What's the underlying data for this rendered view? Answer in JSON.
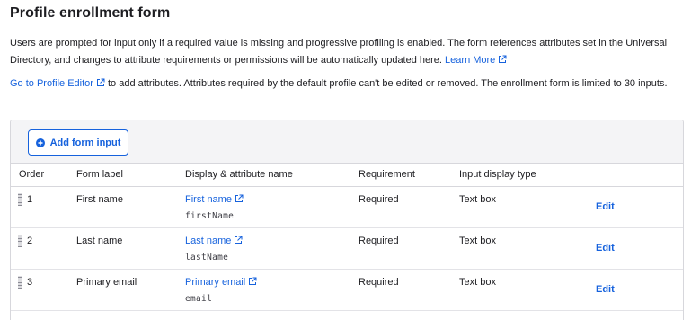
{
  "page": {
    "title": "Profile enrollment form",
    "intro_text": "Users are prompted for input only if a required value is missing and progressive profiling is enabled. The form references attributes set in the Universal Directory, and changes to attribute requirements or permissions will be automatically updated here.",
    "learn_more_label": "Learn More",
    "profile_editor_link": "Go to Profile Editor",
    "profile_editor_text": "to add attributes. Attributes required by the default profile can't be edited or removed. The enrollment form is limited to 30 inputs."
  },
  "toolbar": {
    "add_form_input_label": "Add form input",
    "add_icon": "plus-circle-icon"
  },
  "table": {
    "columns": [
      "Order",
      "Form label",
      "Display & attribute name",
      "Requirement",
      "Input display type",
      ""
    ],
    "rows": [
      {
        "order": "1",
        "form_label": "First name",
        "display_name": "First name",
        "attribute": "firstName",
        "requirement": "Required",
        "input_type": "Text box",
        "action": "Edit"
      },
      {
        "order": "2",
        "form_label": "Last name",
        "display_name": "Last name",
        "attribute": "lastName",
        "requirement": "Required",
        "input_type": "Text box",
        "action": "Edit"
      },
      {
        "order": "3",
        "form_label": "Primary email",
        "display_name": "Primary email",
        "attribute": "email",
        "requirement": "Required",
        "input_type": "Text box",
        "action": "Edit"
      }
    ]
  },
  "colors": {
    "accent": "#1662dd",
    "text": "#1d1d21",
    "header_bg": "#f4f4f6",
    "border": "#d7d7dc"
  },
  "icons": {
    "external_link": "external-link-icon",
    "drag_handle": "drag-handle-icon"
  }
}
